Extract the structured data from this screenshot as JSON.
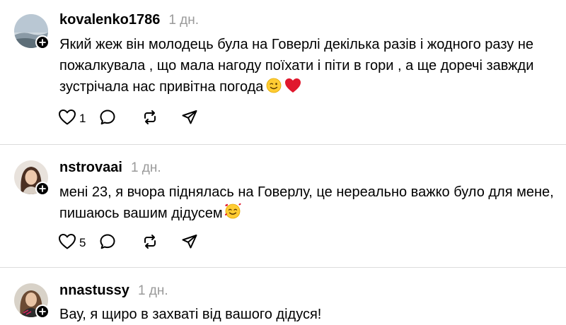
{
  "comments": [
    {
      "username": "kovalenko1786",
      "time": "1 дн.",
      "text": "Який жеж він молодець була на Говерлі декілька разів і жодного разу не пожалкувала , що мала нагоду поїхати і піти в гори , а ще доречі завжди зустрічала нас привітна погода",
      "emojis": [
        "wink-emoji",
        "red-heart-emoji"
      ],
      "likes": "1"
    },
    {
      "username": "nstrovaai",
      "time": "1 дн.",
      "text": "мені 23, я вчора піднялась на Говерлу, це нереально важко було для мене, пишаюсь вашим дідусем",
      "emojis": [
        "smiling-hearts-emoji"
      ],
      "likes": "5"
    },
    {
      "username": "nnastussy",
      "time": "1 дн.",
      "text": "Вау, я щиро в захваті від вашого дідуся!",
      "emojis": [],
      "likes": ""
    }
  ],
  "icons": {
    "like": "heart-outline-icon",
    "reply": "speech-bubble-icon",
    "repost": "repost-arrows-icon",
    "share": "paper-plane-icon",
    "follow": "plus-icon"
  },
  "colors": {
    "text": "#000000",
    "meta": "#9a9a9a",
    "divider": "#dcdcdc",
    "heart": "#e0182d"
  }
}
